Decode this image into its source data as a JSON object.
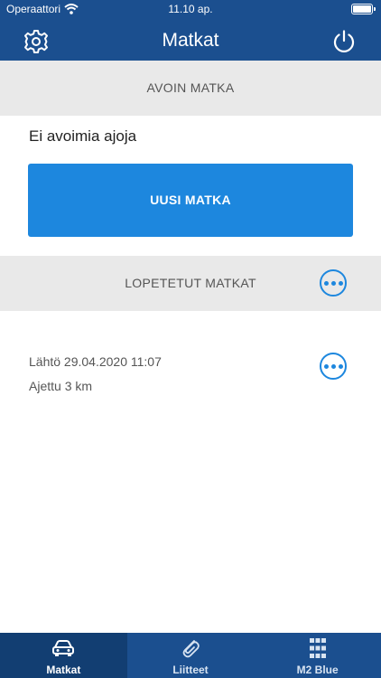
{
  "status_bar": {
    "carrier": "Operaattori",
    "time": "11.10 ap."
  },
  "header": {
    "title": "Matkat"
  },
  "open_trip": {
    "header": "AVOIN MATKA",
    "empty_text": "Ei avoimia ajoja",
    "new_trip_label": "UUSI MATKA"
  },
  "finished_trips": {
    "header": "LOPETETUT MATKAT",
    "items": [
      {
        "start": "Lähtö 29.04.2020 11:07",
        "distance": "Ajettu 3 km"
      }
    ]
  },
  "tabbar": {
    "tabs": [
      {
        "label": "Matkat",
        "icon": "car-icon",
        "active": true
      },
      {
        "label": "Liitteet",
        "icon": "paperclip-icon",
        "active": false
      },
      {
        "label": "M2 Blue",
        "icon": "grid-icon",
        "active": false
      }
    ]
  },
  "colors": {
    "primary": "#1b4f8f",
    "accent": "#1d87de",
    "section_bg": "#e9e9e9"
  }
}
